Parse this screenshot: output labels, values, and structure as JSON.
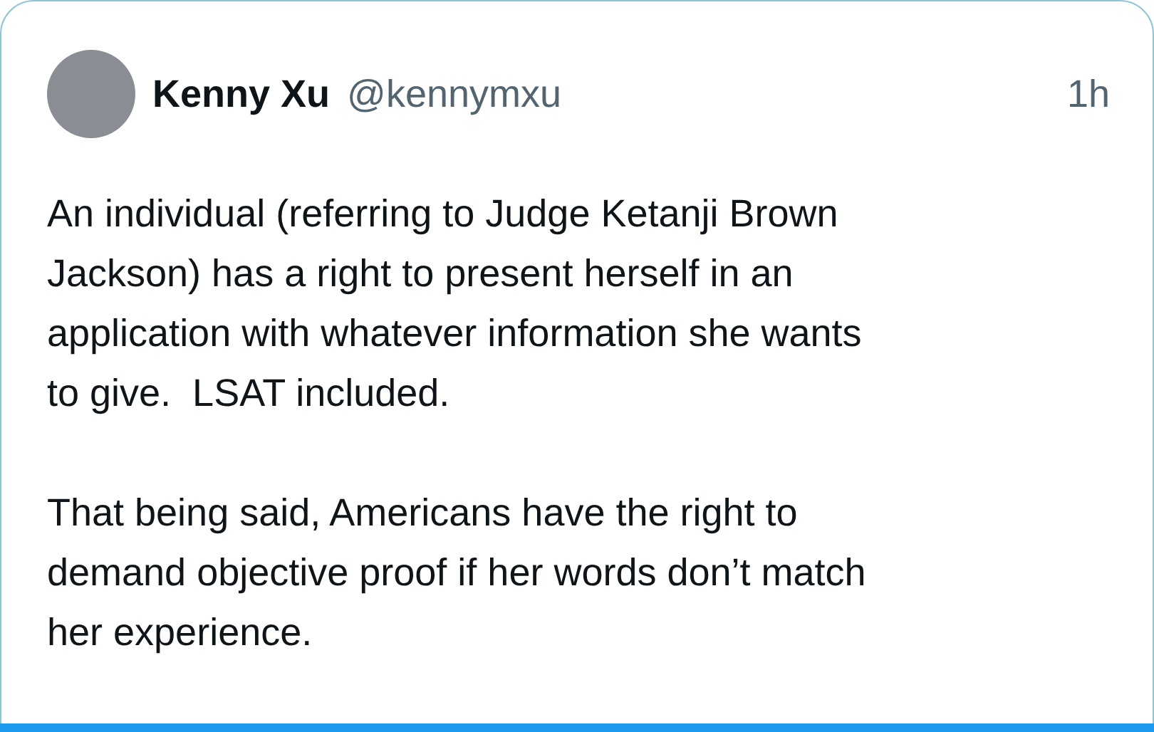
{
  "tweet": {
    "author": {
      "name": "Kenny Xu",
      "handle": "@kennymxu"
    },
    "time": "1h",
    "paragraphs": [
      "An individual (referring to Judge Ketanji Brown\nJackson) has a right to present herself in an\napplication with whatever information she wants\nto give.  LSAT included.",
      "That being said, Americans have the right to\ndemand objective proof if her words don’t match\nher experience."
    ]
  }
}
